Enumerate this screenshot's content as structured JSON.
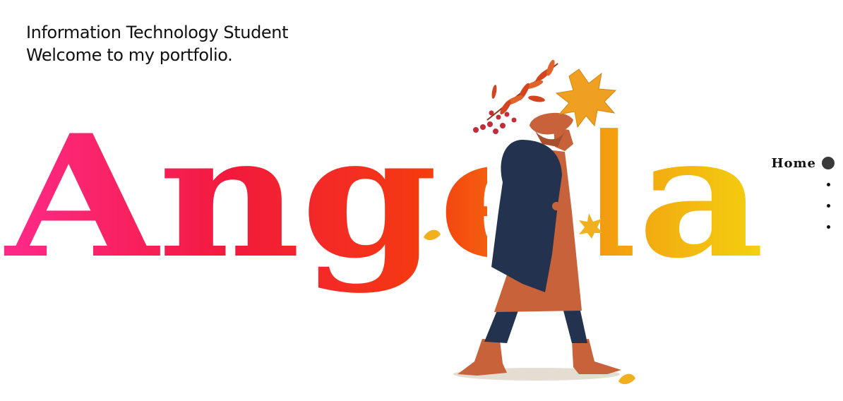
{
  "intro": {
    "line1": "Information Technology Student",
    "line2": "Welcome to my portfolio."
  },
  "hero": {
    "name": "Angela",
    "gradient": [
      "#ff2a8a",
      "#f21a3c",
      "#f53a10",
      "#f39a10",
      "#f3d20f"
    ],
    "illustration": "woman-walking-autumn-leaves",
    "colors": {
      "coat": "#c8623a",
      "jacket": "#22324f",
      "hair": "#c8623a",
      "legs": "#22324f",
      "leaf_orange": "#f0a020",
      "leaf_red": "#d4451f",
      "shadow": "#e3ddd2"
    }
  },
  "nav": {
    "active_label": "Home",
    "items": [
      {
        "label": "Home",
        "active": true
      },
      {
        "label": "",
        "active": false
      },
      {
        "label": "",
        "active": false
      },
      {
        "label": "",
        "active": false
      }
    ]
  }
}
